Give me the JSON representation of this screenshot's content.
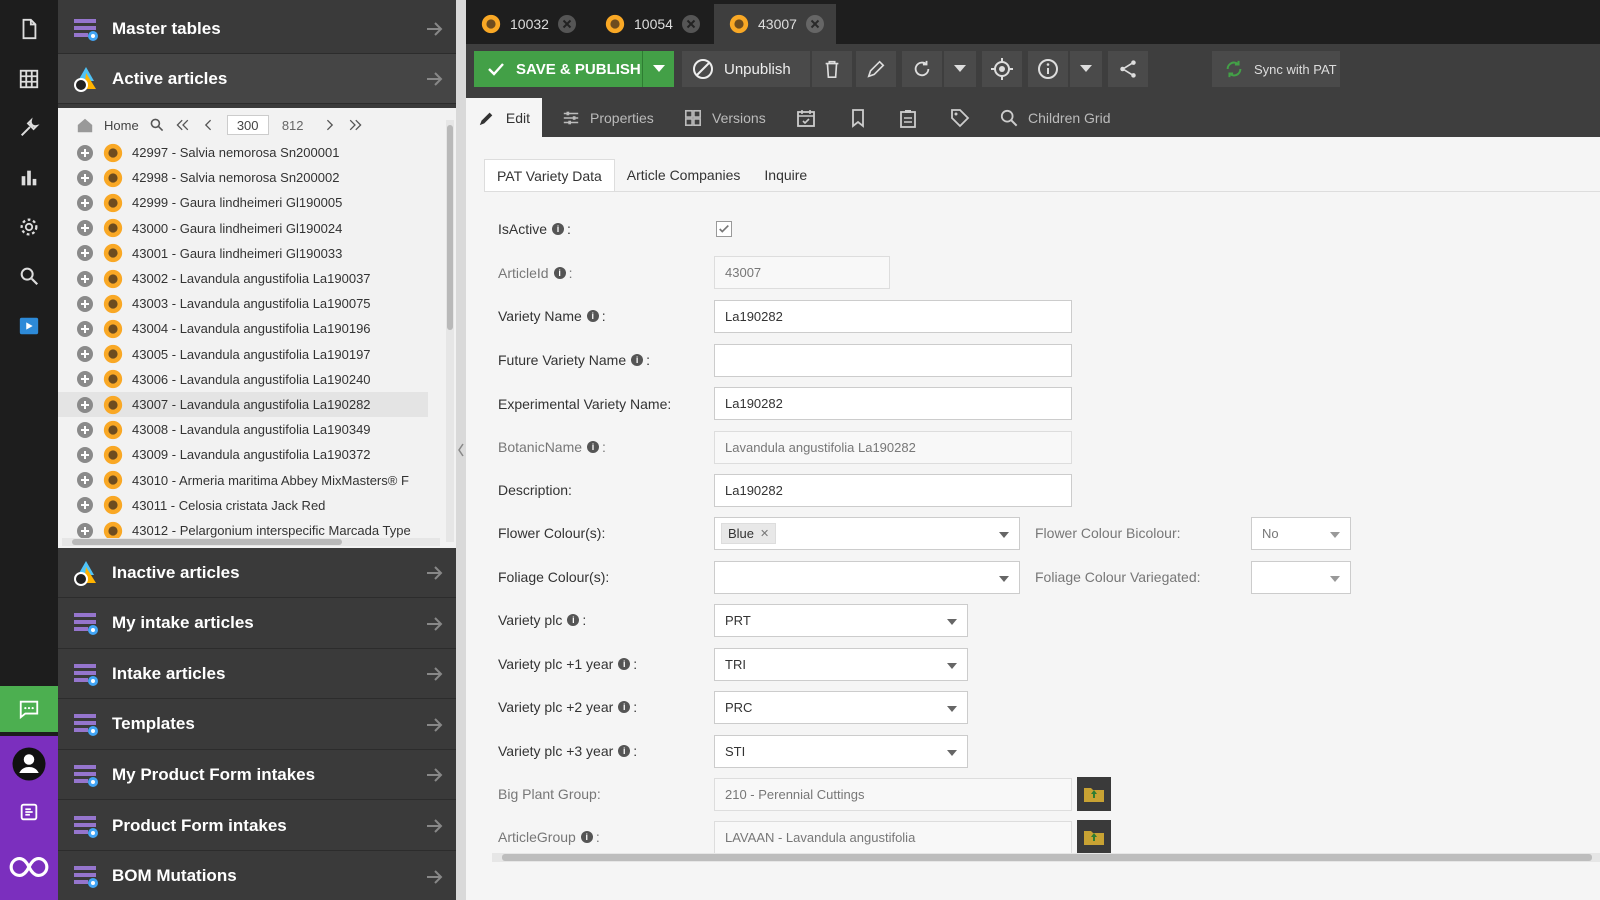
{
  "left_panel": {
    "sections": [
      {
        "label": "Master tables"
      },
      {
        "label": "Active articles"
      },
      {
        "label": "Inactive articles"
      },
      {
        "label": "My intake articles"
      },
      {
        "label": "Intake articles"
      },
      {
        "label": "Templates"
      },
      {
        "label": "My Product Form intakes"
      },
      {
        "label": "Product Form intakes"
      },
      {
        "label": "BOM Mutations"
      }
    ],
    "tree": {
      "home_label": "Home",
      "page_value": "300",
      "page_total": "812",
      "items": [
        {
          "label": "42997 - Salvia nemorosa Sn200001"
        },
        {
          "label": "42998 - Salvia nemorosa Sn200002"
        },
        {
          "label": "42999 - Gaura lindheimeri Gl190005"
        },
        {
          "label": "43000 - Gaura lindheimeri Gl190024"
        },
        {
          "label": "43001 - Gaura lindheimeri Gl190033"
        },
        {
          "label": "43002 - Lavandula angustifolia La190037"
        },
        {
          "label": "43003 - Lavandula angustifolia La190075"
        },
        {
          "label": "43004 - Lavandula angustifolia La190196"
        },
        {
          "label": "43005 - Lavandula angustifolia La190197"
        },
        {
          "label": "43006 - Lavandula angustifolia La190240"
        },
        {
          "label": "43007 - Lavandula angustifolia La190282"
        },
        {
          "label": "43008 - Lavandula angustifolia La190349"
        },
        {
          "label": "43009 - Lavandula angustifolia La190372"
        },
        {
          "label": "43010 - Armeria maritima Abbey MixMasters® F"
        },
        {
          "label": "43011 - Celosia cristata Jack Red"
        },
        {
          "label": "43012 - Pelargonium interspecific Marcada Type"
        }
      ]
    }
  },
  "doc_tabs": [
    {
      "label": "10032"
    },
    {
      "label": "10054"
    },
    {
      "label": "43007"
    }
  ],
  "toolbar": {
    "save_label": "SAVE & PUBLISH",
    "unpublish_label": "Unpublish",
    "sync_label": "Sync with PAT"
  },
  "subtabs": {
    "edit": "Edit",
    "properties": "Properties",
    "versions": "Versions",
    "children_grid": "Children Grid"
  },
  "inner_tabs": [
    {
      "label": "PAT Variety Data"
    },
    {
      "label": "Article Companies"
    },
    {
      "label": "Inquire"
    }
  ],
  "form": {
    "is_active_label": "IsActive",
    "article_id_label": "ArticleId",
    "article_id_value": "43007",
    "variety_name_label": "Variety Name",
    "variety_name_value": "La190282",
    "future_variety_name_label": "Future Variety Name",
    "future_variety_name_value": "",
    "experimental_variety_name_label": "Experimental Variety Name:",
    "experimental_variety_name_value": "La190282",
    "botanic_name_label": "BotanicName",
    "botanic_name_value": "Lavandula angustifolia La190282",
    "description_label": "Description:",
    "description_value": "La190282",
    "flower_colours_label": "Flower Colour(s):",
    "flower_colours_tag": "Blue",
    "flower_colour_bicolour_label": "Flower Colour Bicolour:",
    "flower_colour_bicolour_value": "No",
    "foliage_colours_label": "Foliage Colour(s):",
    "foliage_colour_variegated_label": "Foliage Colour Variegated:",
    "variety_plc_label": "Variety plc",
    "variety_plc_value": "PRT",
    "variety_plc_1_label": "Variety plc +1 year",
    "variety_plc_1_value": "TRI",
    "variety_plc_2_label": "Variety plc +2 year",
    "variety_plc_2_value": "PRC",
    "variety_plc_3_label": "Variety plc +3 year",
    "variety_plc_3_value": "STI",
    "big_plant_group_label": "Big Plant Group:",
    "big_plant_group_value": "210 - Perennial Cuttings",
    "article_group_label": "ArticleGroup",
    "article_group_value": "LAVAAN - Lavandula angustifolia"
  },
  "colors": {
    "accent_green": "#43a047",
    "rail_bg": "#1d1d1d",
    "panel_bg": "#3a3a3a",
    "chat_green": "#4caf50",
    "account_purple": "#7b2fbe"
  }
}
